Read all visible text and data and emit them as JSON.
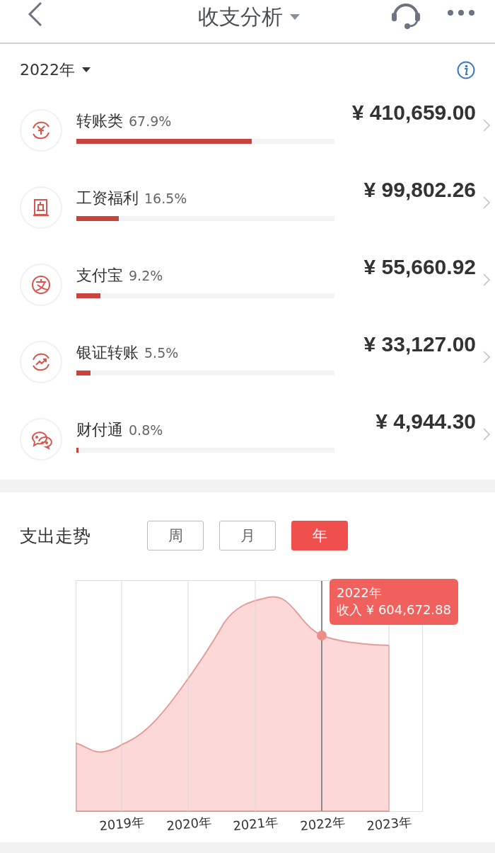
{
  "header": {
    "title": "收支分析"
  },
  "year_filter": {
    "label": "2022年"
  },
  "categories": [
    {
      "name": "转账类",
      "percent": "67.9%",
      "amount": "¥ 410,659.00",
      "level": 0.679
    },
    {
      "name": "工资福利",
      "percent": "16.5%",
      "amount": "¥ 99,802.26",
      "level": 0.165
    },
    {
      "name": "支付宝",
      "percent": "9.2%",
      "amount": "¥ 55,660.92",
      "level": 0.092
    },
    {
      "name": "银证转账",
      "percent": "5.5%",
      "amount": "¥ 33,127.00",
      "level": 0.055
    },
    {
      "name": "财付通",
      "percent": "0.8%",
      "amount": "¥ 4,944.30",
      "level": 0.008
    }
  ],
  "trend": {
    "title": "支出走势",
    "periods": [
      {
        "label": "周",
        "selected": false
      },
      {
        "label": "月",
        "selected": false
      },
      {
        "label": "年",
        "selected": true
      }
    ],
    "tooltip": {
      "year": "2022年",
      "value": "收入 ¥ 604,672.88"
    },
    "x_labels": [
      "2019年",
      "2020年",
      "2021年",
      "2022年",
      "2023年"
    ]
  }
}
